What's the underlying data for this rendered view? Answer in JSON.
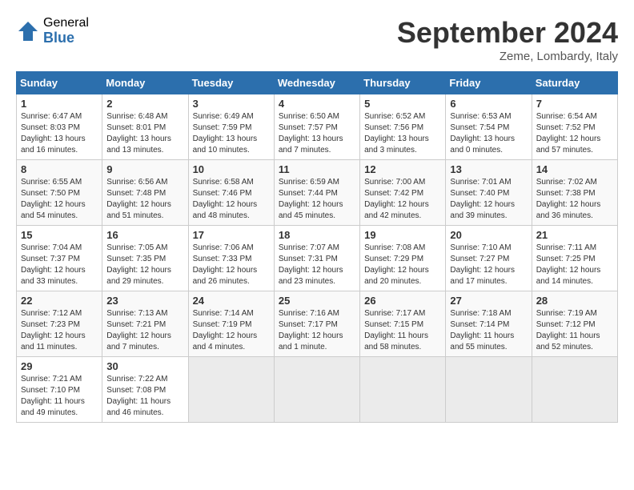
{
  "header": {
    "logo_general": "General",
    "logo_blue": "Blue",
    "title": "September 2024",
    "location": "Zeme, Lombardy, Italy"
  },
  "days_of_week": [
    "Sunday",
    "Monday",
    "Tuesday",
    "Wednesday",
    "Thursday",
    "Friday",
    "Saturday"
  ],
  "weeks": [
    [
      {
        "day": 1,
        "lines": [
          "Sunrise: 6:47 AM",
          "Sunset: 8:03 PM",
          "Daylight: 13 hours",
          "and 16 minutes."
        ]
      },
      {
        "day": 2,
        "lines": [
          "Sunrise: 6:48 AM",
          "Sunset: 8:01 PM",
          "Daylight: 13 hours",
          "and 13 minutes."
        ]
      },
      {
        "day": 3,
        "lines": [
          "Sunrise: 6:49 AM",
          "Sunset: 7:59 PM",
          "Daylight: 13 hours",
          "and 10 minutes."
        ]
      },
      {
        "day": 4,
        "lines": [
          "Sunrise: 6:50 AM",
          "Sunset: 7:57 PM",
          "Daylight: 13 hours",
          "and 7 minutes."
        ]
      },
      {
        "day": 5,
        "lines": [
          "Sunrise: 6:52 AM",
          "Sunset: 7:56 PM",
          "Daylight: 13 hours",
          "and 3 minutes."
        ]
      },
      {
        "day": 6,
        "lines": [
          "Sunrise: 6:53 AM",
          "Sunset: 7:54 PM",
          "Daylight: 13 hours",
          "and 0 minutes."
        ]
      },
      {
        "day": 7,
        "lines": [
          "Sunrise: 6:54 AM",
          "Sunset: 7:52 PM",
          "Daylight: 12 hours",
          "and 57 minutes."
        ]
      }
    ],
    [
      {
        "day": 8,
        "lines": [
          "Sunrise: 6:55 AM",
          "Sunset: 7:50 PM",
          "Daylight: 12 hours",
          "and 54 minutes."
        ]
      },
      {
        "day": 9,
        "lines": [
          "Sunrise: 6:56 AM",
          "Sunset: 7:48 PM",
          "Daylight: 12 hours",
          "and 51 minutes."
        ]
      },
      {
        "day": 10,
        "lines": [
          "Sunrise: 6:58 AM",
          "Sunset: 7:46 PM",
          "Daylight: 12 hours",
          "and 48 minutes."
        ]
      },
      {
        "day": 11,
        "lines": [
          "Sunrise: 6:59 AM",
          "Sunset: 7:44 PM",
          "Daylight: 12 hours",
          "and 45 minutes."
        ]
      },
      {
        "day": 12,
        "lines": [
          "Sunrise: 7:00 AM",
          "Sunset: 7:42 PM",
          "Daylight: 12 hours",
          "and 42 minutes."
        ]
      },
      {
        "day": 13,
        "lines": [
          "Sunrise: 7:01 AM",
          "Sunset: 7:40 PM",
          "Daylight: 12 hours",
          "and 39 minutes."
        ]
      },
      {
        "day": 14,
        "lines": [
          "Sunrise: 7:02 AM",
          "Sunset: 7:38 PM",
          "Daylight: 12 hours",
          "and 36 minutes."
        ]
      }
    ],
    [
      {
        "day": 15,
        "lines": [
          "Sunrise: 7:04 AM",
          "Sunset: 7:37 PM",
          "Daylight: 12 hours",
          "and 33 minutes."
        ]
      },
      {
        "day": 16,
        "lines": [
          "Sunrise: 7:05 AM",
          "Sunset: 7:35 PM",
          "Daylight: 12 hours",
          "and 29 minutes."
        ]
      },
      {
        "day": 17,
        "lines": [
          "Sunrise: 7:06 AM",
          "Sunset: 7:33 PM",
          "Daylight: 12 hours",
          "and 26 minutes."
        ]
      },
      {
        "day": 18,
        "lines": [
          "Sunrise: 7:07 AM",
          "Sunset: 7:31 PM",
          "Daylight: 12 hours",
          "and 23 minutes."
        ]
      },
      {
        "day": 19,
        "lines": [
          "Sunrise: 7:08 AM",
          "Sunset: 7:29 PM",
          "Daylight: 12 hours",
          "and 20 minutes."
        ]
      },
      {
        "day": 20,
        "lines": [
          "Sunrise: 7:10 AM",
          "Sunset: 7:27 PM",
          "Daylight: 12 hours",
          "and 17 minutes."
        ]
      },
      {
        "day": 21,
        "lines": [
          "Sunrise: 7:11 AM",
          "Sunset: 7:25 PM",
          "Daylight: 12 hours",
          "and 14 minutes."
        ]
      }
    ],
    [
      {
        "day": 22,
        "lines": [
          "Sunrise: 7:12 AM",
          "Sunset: 7:23 PM",
          "Daylight: 12 hours",
          "and 11 minutes."
        ]
      },
      {
        "day": 23,
        "lines": [
          "Sunrise: 7:13 AM",
          "Sunset: 7:21 PM",
          "Daylight: 12 hours",
          "and 7 minutes."
        ]
      },
      {
        "day": 24,
        "lines": [
          "Sunrise: 7:14 AM",
          "Sunset: 7:19 PM",
          "Daylight: 12 hours",
          "and 4 minutes."
        ]
      },
      {
        "day": 25,
        "lines": [
          "Sunrise: 7:16 AM",
          "Sunset: 7:17 PM",
          "Daylight: 12 hours",
          "and 1 minute."
        ]
      },
      {
        "day": 26,
        "lines": [
          "Sunrise: 7:17 AM",
          "Sunset: 7:15 PM",
          "Daylight: 11 hours",
          "and 58 minutes."
        ]
      },
      {
        "day": 27,
        "lines": [
          "Sunrise: 7:18 AM",
          "Sunset: 7:14 PM",
          "Daylight: 11 hours",
          "and 55 minutes."
        ]
      },
      {
        "day": 28,
        "lines": [
          "Sunrise: 7:19 AM",
          "Sunset: 7:12 PM",
          "Daylight: 11 hours",
          "and 52 minutes."
        ]
      }
    ],
    [
      {
        "day": 29,
        "lines": [
          "Sunrise: 7:21 AM",
          "Sunset: 7:10 PM",
          "Daylight: 11 hours",
          "and 49 minutes."
        ]
      },
      {
        "day": 30,
        "lines": [
          "Sunrise: 7:22 AM",
          "Sunset: 7:08 PM",
          "Daylight: 11 hours",
          "and 46 minutes."
        ]
      },
      null,
      null,
      null,
      null,
      null
    ]
  ]
}
